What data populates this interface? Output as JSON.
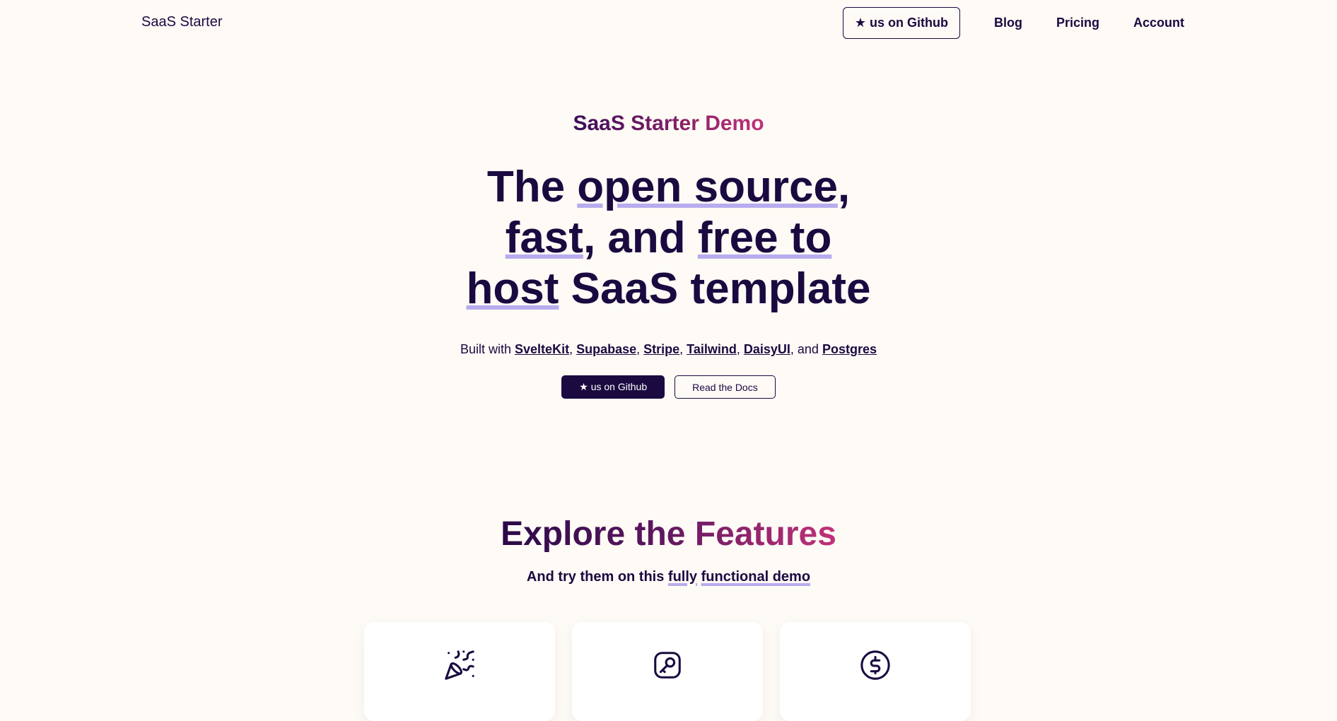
{
  "navbar": {
    "brand": "SaaS Starter",
    "github_button": "★ us on Github",
    "links": [
      "Blog",
      "Pricing",
      "Account"
    ]
  },
  "hero": {
    "eyebrow": "SaaS Starter Demo",
    "title": {
      "w1": "The ",
      "w2": "open source",
      "w3": ",",
      "w4": "fast",
      "w5": ", and ",
      "w6": "free to",
      "w7": "host",
      "w8": " SaaS template"
    },
    "built_with": {
      "prefix": "Built with ",
      "techs": [
        "SvelteKit",
        "Supabase",
        "Stripe",
        "Tailwind",
        "DaisyUI",
        "Postgres"
      ],
      "sep": ", ",
      "and": ", and "
    },
    "buttons": {
      "github": "★ us on Github",
      "docs": "Read the Docs"
    }
  },
  "features": {
    "title_a": "Explore the ",
    "title_b": "Features",
    "sub_prefix": "And try them on this ",
    "sub_u1": "fully",
    "sub_space": " ",
    "sub_u2": "functional demo",
    "cards": [
      {
        "icon": "party-popper-icon"
      },
      {
        "icon": "key-icon"
      },
      {
        "icon": "dollar-circle-icon"
      }
    ]
  },
  "colors": {
    "background": "#fefaf6",
    "text": "#1a0a40",
    "underline": "#b8acee",
    "gradient_start": "#3a0d5a",
    "gradient_end": "#c2327a"
  }
}
